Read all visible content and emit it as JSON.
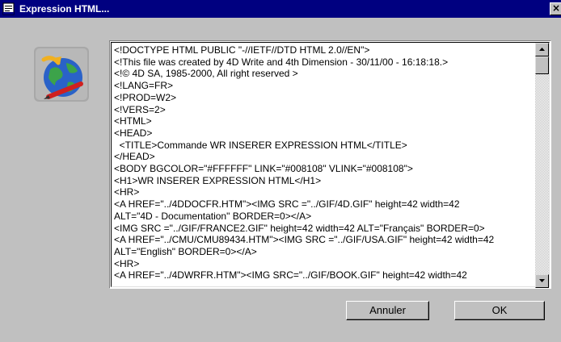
{
  "window": {
    "title": "Expression HTML...",
    "close_glyph": "×",
    "app_icon": "document-icon",
    "logo_icon": "globe-pen-icon"
  },
  "editor": {
    "lines": [
      "<!DOCTYPE HTML PUBLIC \"-//IETF//DTD HTML 2.0//EN\">",
      "<!This file was created by 4D Write and 4th Dimension - 30/11/00 - 16:18:18.>",
      "<!© 4D SA, 1985-2000, All right reserved >",
      "<!LANG=FR>",
      "<!PROD=W2>",
      "<!VERS=2>",
      "<HTML>",
      "<HEAD>",
      "  <TITLE>Commande WR INSERER EXPRESSION HTML</TITLE>",
      "</HEAD>",
      "<BODY BGCOLOR=\"#FFFFFF\" LINK=\"#008108\" VLINK=\"#008108\">",
      "<H1>WR INSERER EXPRESSION HTML</H1>",
      "<HR>",
      "<A HREF=\"../4DDOCFR.HTM\"><IMG SRC =\"../GIF/4D.GIF\" height=42 width=42",
      "ALT=\"4D - Documentation\" BORDER=0></A>",
      "<IMG SRC =\"../GIF/FRANCE2.GIF\" height=42 width=42 ALT=\"Français\" BORDER=0>",
      "<A HREF=\"../CMU/CMU89434.HTM\"><IMG SRC =\"../GIF/USA.GIF\" height=42 width=42",
      "ALT=\"English\" BORDER=0></A>",
      "<HR>",
      "<A HREF=\"../4DWRFR.HTM\"><IMG SRC=\"../GIF/BOOK.GIF\" height=42 width=42"
    ]
  },
  "buttons": {
    "cancel_label": "Annuler",
    "ok_label": "OK"
  },
  "colors": {
    "titlebar": "#000080",
    "face": "#c0c0c0"
  }
}
